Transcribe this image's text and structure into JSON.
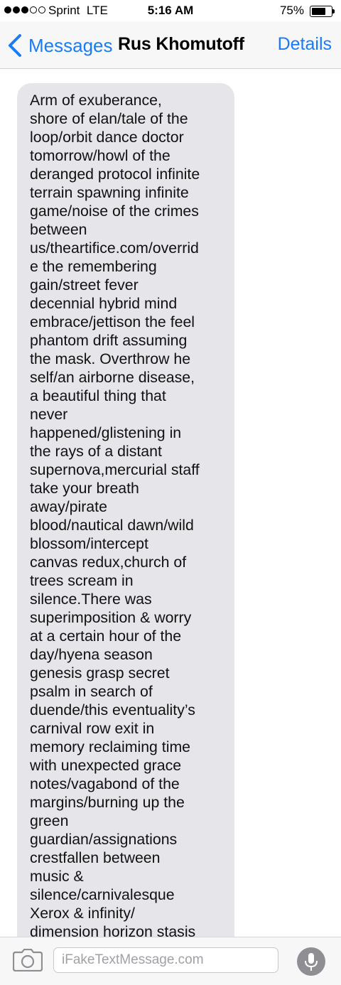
{
  "status_bar": {
    "signal_strength": "3 of 5",
    "carrier": "Sprint",
    "network": "LTE",
    "time": "5:16 AM",
    "battery_percent": "75%",
    "battery_level": 0.75
  },
  "nav": {
    "back_label": "Messages",
    "contact_name": "Rus Khomutoff",
    "details_label": "Details",
    "accent_color": "#1a7cf5"
  },
  "message": {
    "text": "Arm of exuberance,\nshore of elan/tale of the\nloop/orbit dance doctor\ntomorrow/howl of the\nderanged protocol infinite\nterrain spawning infinite\ngame/noise of the crimes\nbetween\nus/theartifice.com/overrid\ne the remembering\ngain/street fever\ndecennial hybrid mind\nembrace/jettison the feel\nphantom drift assuming\nthe mask. Overthrow he\nself/an airborne disease,\na beautiful thing that\nnever\nhappened/glistening in\nthe rays of a distant\nsupernova,mercurial staff\ntake your breath\naway/pirate\nblood/nautical dawn/wild\nblossom/intercept\ncanvas redux,church of\ntrees scream in\nsilence.There was\nsuperimposition & worry\nat a certain hour of the\nday/hyena season\ngenesis grasp secret\npsalm in search of\nduende/this eventuality’s\ncarnival row exit in\nmemory reclaiming time\nwith unexpected grace\nnotes/vagabond of the\nmargins/burning up the\ngreen\nguardian/assignations\ncrestfallen between\nmusic &\nsilence/carnivalesque\nXerox & infinity/\ndimension horizon stasis",
    "bubble_color": "#e5e5ea"
  },
  "input_bar": {
    "placeholder": "iFakeTextMessage.com",
    "camera_icon": "camera-icon",
    "mic_icon": "microphone-icon"
  }
}
